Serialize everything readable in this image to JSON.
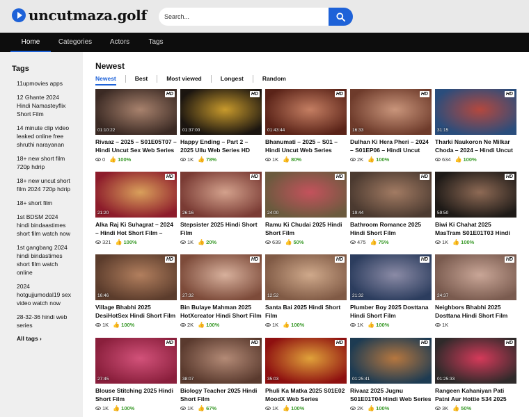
{
  "site": {
    "name": "uncutmaza.golf"
  },
  "search": {
    "placeholder": "Search..."
  },
  "nav": [
    "Home",
    "Categories",
    "Actors",
    "Tags"
  ],
  "sidebar": {
    "title": "Tags",
    "tags": [
      "11upmovies apps",
      "12 Ghante 2024 Hindi Namasteyflix Short Film",
      "14 minute clip video leaked online free shruthi narayanan",
      "18+ new short film 720p hdrip",
      "18+ new uncut short film 2024 720p hdrip",
      "18+ short film",
      "1st BDSM 2024 hindi bindaastimes short film watch now",
      "1st gangbang 2024 hindi bindastimes short film watch online",
      "2024 hotgujjumodal19 sex video watch now",
      "28-32-36 hindi web series"
    ],
    "all_tags": "All tags ›"
  },
  "main": {
    "title": "Newest",
    "tabs": [
      "Newest",
      "Best",
      "Most viewed",
      "Longest",
      "Random"
    ]
  },
  "videos": [
    {
      "title": "Rivaaz – 2025 – S01E05T07 – Hindi Uncut Sex Web Series –",
      "duration": "01:10:22",
      "views": "0",
      "rating": "100%",
      "c1": "#3b2a24",
      "c2": "#a8826d"
    },
    {
      "title": "Happy Ending – Part 2 – 2025 Ullu Web Series HD",
      "duration": "01:37:00",
      "views": "1K",
      "rating": "78%",
      "c1": "#1b1510",
      "c2": "#c89a2c"
    },
    {
      "title": "Bhanumati – 2025 – S01 – Hindi Uncut Web Series",
      "duration": "01:43:44",
      "views": "1K",
      "rating": "80%",
      "c1": "#5a2318",
      "c2": "#c47e62"
    },
    {
      "title": "Dulhan Ki Hera Pheri – 2024 – S01EP06 – Hindi Uncut Web",
      "duration": "16:33",
      "views": "2K",
      "rating": "100%",
      "c1": "#6e3b2b",
      "c2": "#c9957b"
    },
    {
      "title": "Tharki Naukoron Ne Milkar Choda – 2024 – Hindi Uncut",
      "duration": "31:15",
      "views": "634",
      "rating": "100%",
      "c1": "#2a4d7c",
      "c2": "#b4483e"
    },
    {
      "title": "Alka Raj Ki Suhagrat – 2024 – Hindi Hot Short Film –",
      "duration": "21:20",
      "views": "321",
      "rating": "100%",
      "c1": "#8d1c2b",
      "c2": "#d9a05b"
    },
    {
      "title": "Stepsister 2025 Hindi Short Film",
      "duration": "26:16",
      "views": "1K",
      "rating": "20%",
      "c1": "#7a3b34",
      "c2": "#d3a18c"
    },
    {
      "title": "Ramu Ki Chudai 2025 Hindi Short Film",
      "duration": "24:00",
      "views": "639",
      "rating": "50%",
      "c1": "#6b5a3e",
      "c2": "#c4525c"
    },
    {
      "title": "Bathroom Romance 2025 Hindi Short Film",
      "duration": "19:44",
      "views": "475",
      "rating": "75%",
      "c1": "#4b3a30",
      "c2": "#a27b63"
    },
    {
      "title": "Biwi Ki Chahat 2025 MasTram S01E01T03 Hindi Web Series",
      "duration": "59:50",
      "views": "1K",
      "rating": "100%",
      "c1": "#1e1a17",
      "c2": "#8e6a55"
    },
    {
      "title": "Village Bhabhi 2025 DesiHotSex Hindi Short Film",
      "duration": "16:46",
      "views": "1K",
      "rating": "100%",
      "c1": "#5b3c2c",
      "c2": "#b27f5e"
    },
    {
      "title": "Bin Bulaye Mahman 2025 HotXcreator Hindi Short Film",
      "duration": "27:32",
      "views": "2K",
      "rating": "100%",
      "c1": "#7d4b3a",
      "c2": "#d7b09c"
    },
    {
      "title": "Santa Bai 2025 Hindi Short Film",
      "duration": "12:52",
      "views": "1K",
      "rating": "100%",
      "c1": "#805a45",
      "c2": "#cfa98b"
    },
    {
      "title": "Plumber Boy 2025 Dosttana Hindi Short Film",
      "duration": "21:32",
      "views": "1K",
      "rating": "100%",
      "c1": "#2c3d5e",
      "c2": "#8b8ba6"
    },
    {
      "title": "Neighbors Bhabhi 2025 Dosttana Hindi Short Film",
      "duration": "24:37",
      "views": "1K",
      "rating": "",
      "c1": "#7a5b4f",
      "c2": "#c9a697"
    },
    {
      "title": "Blouse Stitching 2025 Hindi Short Film",
      "duration": "27:45",
      "views": "1K",
      "rating": "100%",
      "c1": "#8a1f3c",
      "c2": "#d2527a"
    },
    {
      "title": "Biology Teacher 2025 Hindi Short Film",
      "duration": "38:07",
      "views": "1K",
      "rating": "67%",
      "c1": "#5a3a2e",
      "c2": "#b38a76"
    },
    {
      "title": "Phuli Ka Matka 2025 S01E02 MoodX Web Series",
      "duration": "35:03",
      "views": "1K",
      "rating": "100%",
      "c1": "#8e1010",
      "c2": "#e0a23a"
    },
    {
      "title": "Rivaaz 2025 Jugnu S01E01T04 Hindi Web Series",
      "duration": "01:25:41",
      "views": "2K",
      "rating": "100%",
      "c1": "#1d3b52",
      "c2": "#b6773f"
    },
    {
      "title": "Rangeen Kahaniyan Pati Patni Aur Hottie S34 2025 ALTBalaji",
      "duration": "01:25:33",
      "views": "3K",
      "rating": "50%",
      "c1": "#2f2a2a",
      "c2": "#d53a5a"
    }
  ]
}
